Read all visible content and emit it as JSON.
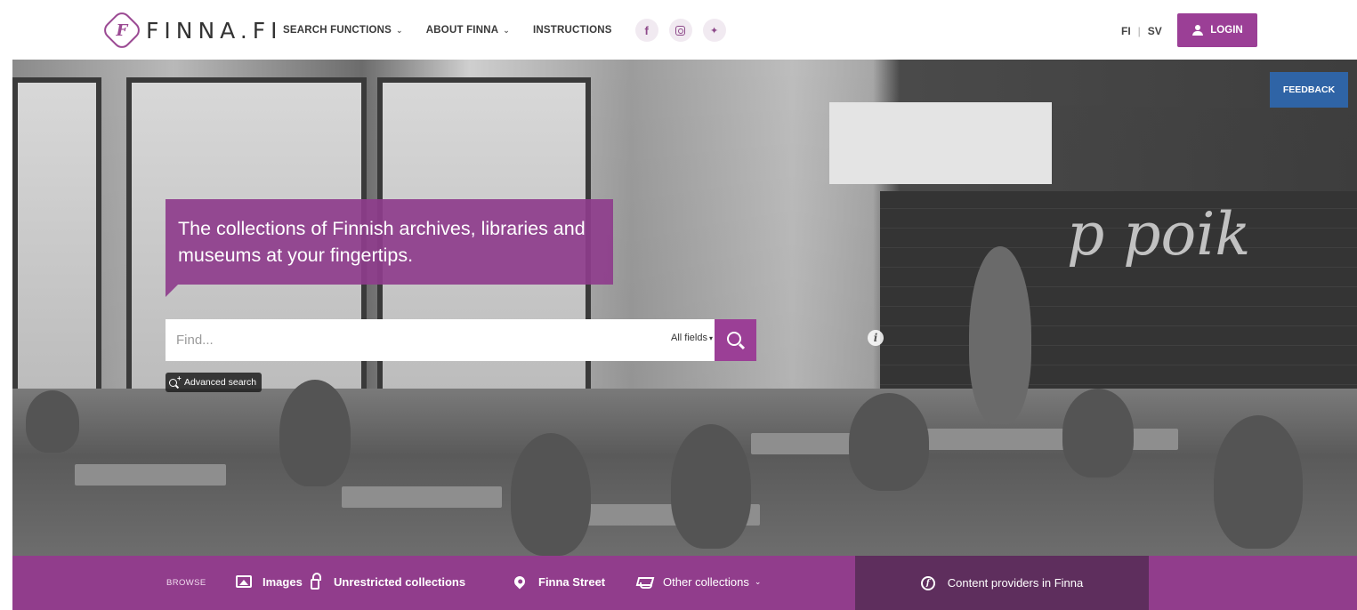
{
  "header": {
    "logo_mark": "F",
    "logo_text": "FINNA.FI",
    "nav": [
      {
        "label": "SEARCH FUNCTIONS",
        "has_dropdown": true
      },
      {
        "label": "ABOUT FINNA",
        "has_dropdown": true
      },
      {
        "label": "INSTRUCTIONS",
        "has_dropdown": false
      }
    ],
    "social": [
      {
        "icon": "facebook-icon",
        "glyph": "f"
      },
      {
        "icon": "instagram-icon",
        "glyph": ""
      },
      {
        "icon": "twitter-icon",
        "glyph": "🐦"
      }
    ],
    "languages": [
      "FI",
      "SV"
    ],
    "login_label": "LOGIN"
  },
  "hero": {
    "feedback_label": "FEEDBACK",
    "tagline": "The collections of Finnish archives, libraries and museums at your fingertips.",
    "search": {
      "placeholder": "Find...",
      "value": "",
      "field_select": "All fields"
    },
    "advanced_search_label": "Advanced search",
    "info_glyph": "i",
    "chalkboard_text": "p  poik"
  },
  "bottombar": {
    "browse_label": "BROWSE",
    "items": [
      {
        "label": "Images",
        "icon": "image-icon"
      },
      {
        "label": "Unrestricted collections",
        "icon": "unlock-icon"
      },
      {
        "label": "Finna Street",
        "icon": "map-pin-icon"
      },
      {
        "label": "Other collections",
        "icon": "graduation-cap-icon"
      }
    ],
    "providers_label": "Content providers in Finna"
  },
  "colors": {
    "brand_purple": "#9b3f96",
    "bar_purple": "#913d8c",
    "providers_dark": "#5e2e5d",
    "feedback_blue": "#2f64a6"
  }
}
